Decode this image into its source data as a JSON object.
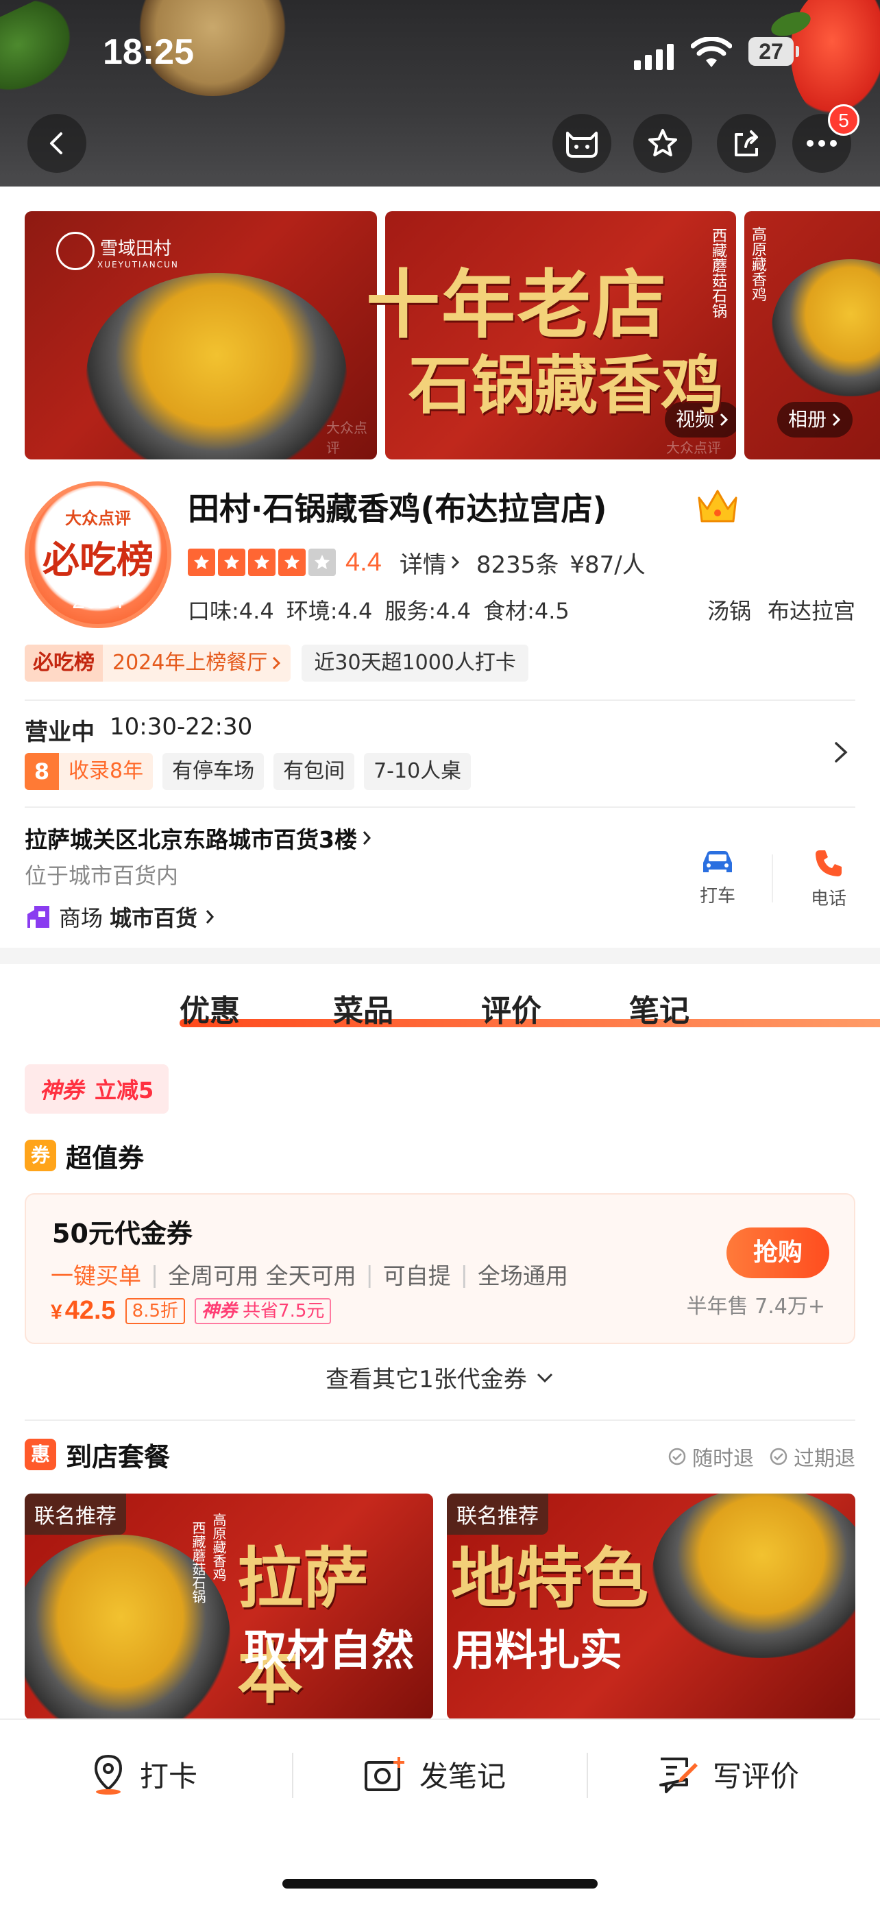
{
  "status_bar": {
    "time": "18:25",
    "battery": "27"
  },
  "nav": {
    "more_badge": "5"
  },
  "gallery": {
    "logo_cn": "雪域田村",
    "logo_en": "XUEYUTIANCUN",
    "headline_1": "十年老店",
    "headline_2": "石锅藏香鸡",
    "vertical_text_a": "西藏蘑菇石锅",
    "vertical_text_b": "高原藏香鸡",
    "watermark": "大众点评",
    "video_label": "视频",
    "album_label": "相册"
  },
  "badge": {
    "top": "大众点评",
    "mid": "必吃榜",
    "year": "2024"
  },
  "shop": {
    "name": "田村·石锅藏香鸡(布达拉宫店)",
    "score": "4.4",
    "stars_filled": 4,
    "details_label": "详情",
    "reviews": "8235条",
    "avg_price": "¥87/人",
    "sub_scores": [
      "口味:4.4",
      "环境:4.4",
      "服务:4.4",
      "食材:4.5"
    ],
    "tags": [
      "汤锅",
      "布达拉宫"
    ]
  },
  "rank": {
    "badge": "必吃榜",
    "text": "2024年上榜餐厅",
    "checkin": "近30天超1000人打卡"
  },
  "hours": {
    "status": "营业中",
    "time": "10:30-22:30"
  },
  "facilities": {
    "years_num": "8",
    "years_text": "收录8年",
    "items": [
      "有停车场",
      "有包间",
      "7-10人桌"
    ]
  },
  "address": {
    "line": "拉萨城关区北京东路城市百货3楼",
    "sub": "位于城市百货内",
    "mall_label": "商场",
    "mall_name": "城市百货"
  },
  "actions": {
    "taxi": "打车",
    "phone": "电话"
  },
  "tabs": [
    "优惠",
    "菜品",
    "评价",
    "笔记"
  ],
  "coupon_tag": {
    "shen": "神券",
    "off": "立减5"
  },
  "value_coupons": {
    "icon": "券",
    "title": "超值券",
    "voucher": {
      "name": "50元代金券",
      "feature_hl": "一键买单",
      "features": [
        "全周可用 全天可用",
        "可自提",
        "全场通用"
      ],
      "currency": "¥",
      "price": "42.5",
      "discount": "8.5折",
      "save_label": "神券",
      "save_text": "共省7.5元",
      "buy": "抢购",
      "sales": "半年售 7.4万+"
    },
    "more": "查看其它1张代金券"
  },
  "packages": {
    "icon": "惠",
    "title": "到店套餐",
    "guarantees": [
      "随时退",
      "过期退"
    ],
    "cards": [
      {
        "label": "联名推荐",
        "big": "拉萨本",
        "small": "取材自然",
        "vert_a": "高原藏香鸡",
        "vert_b": "西藏蘑菇石锅"
      },
      {
        "label": "联名推荐",
        "big": "地特色",
        "small": "用料扎实"
      }
    ]
  },
  "bottom_bar": {
    "checkin": "打卡",
    "note": "发笔记",
    "review": "写评价"
  },
  "colors": {
    "accent": "#ff6633",
    "tag_red": "#ff3040",
    "brand_orange": "#ff4d1f"
  }
}
